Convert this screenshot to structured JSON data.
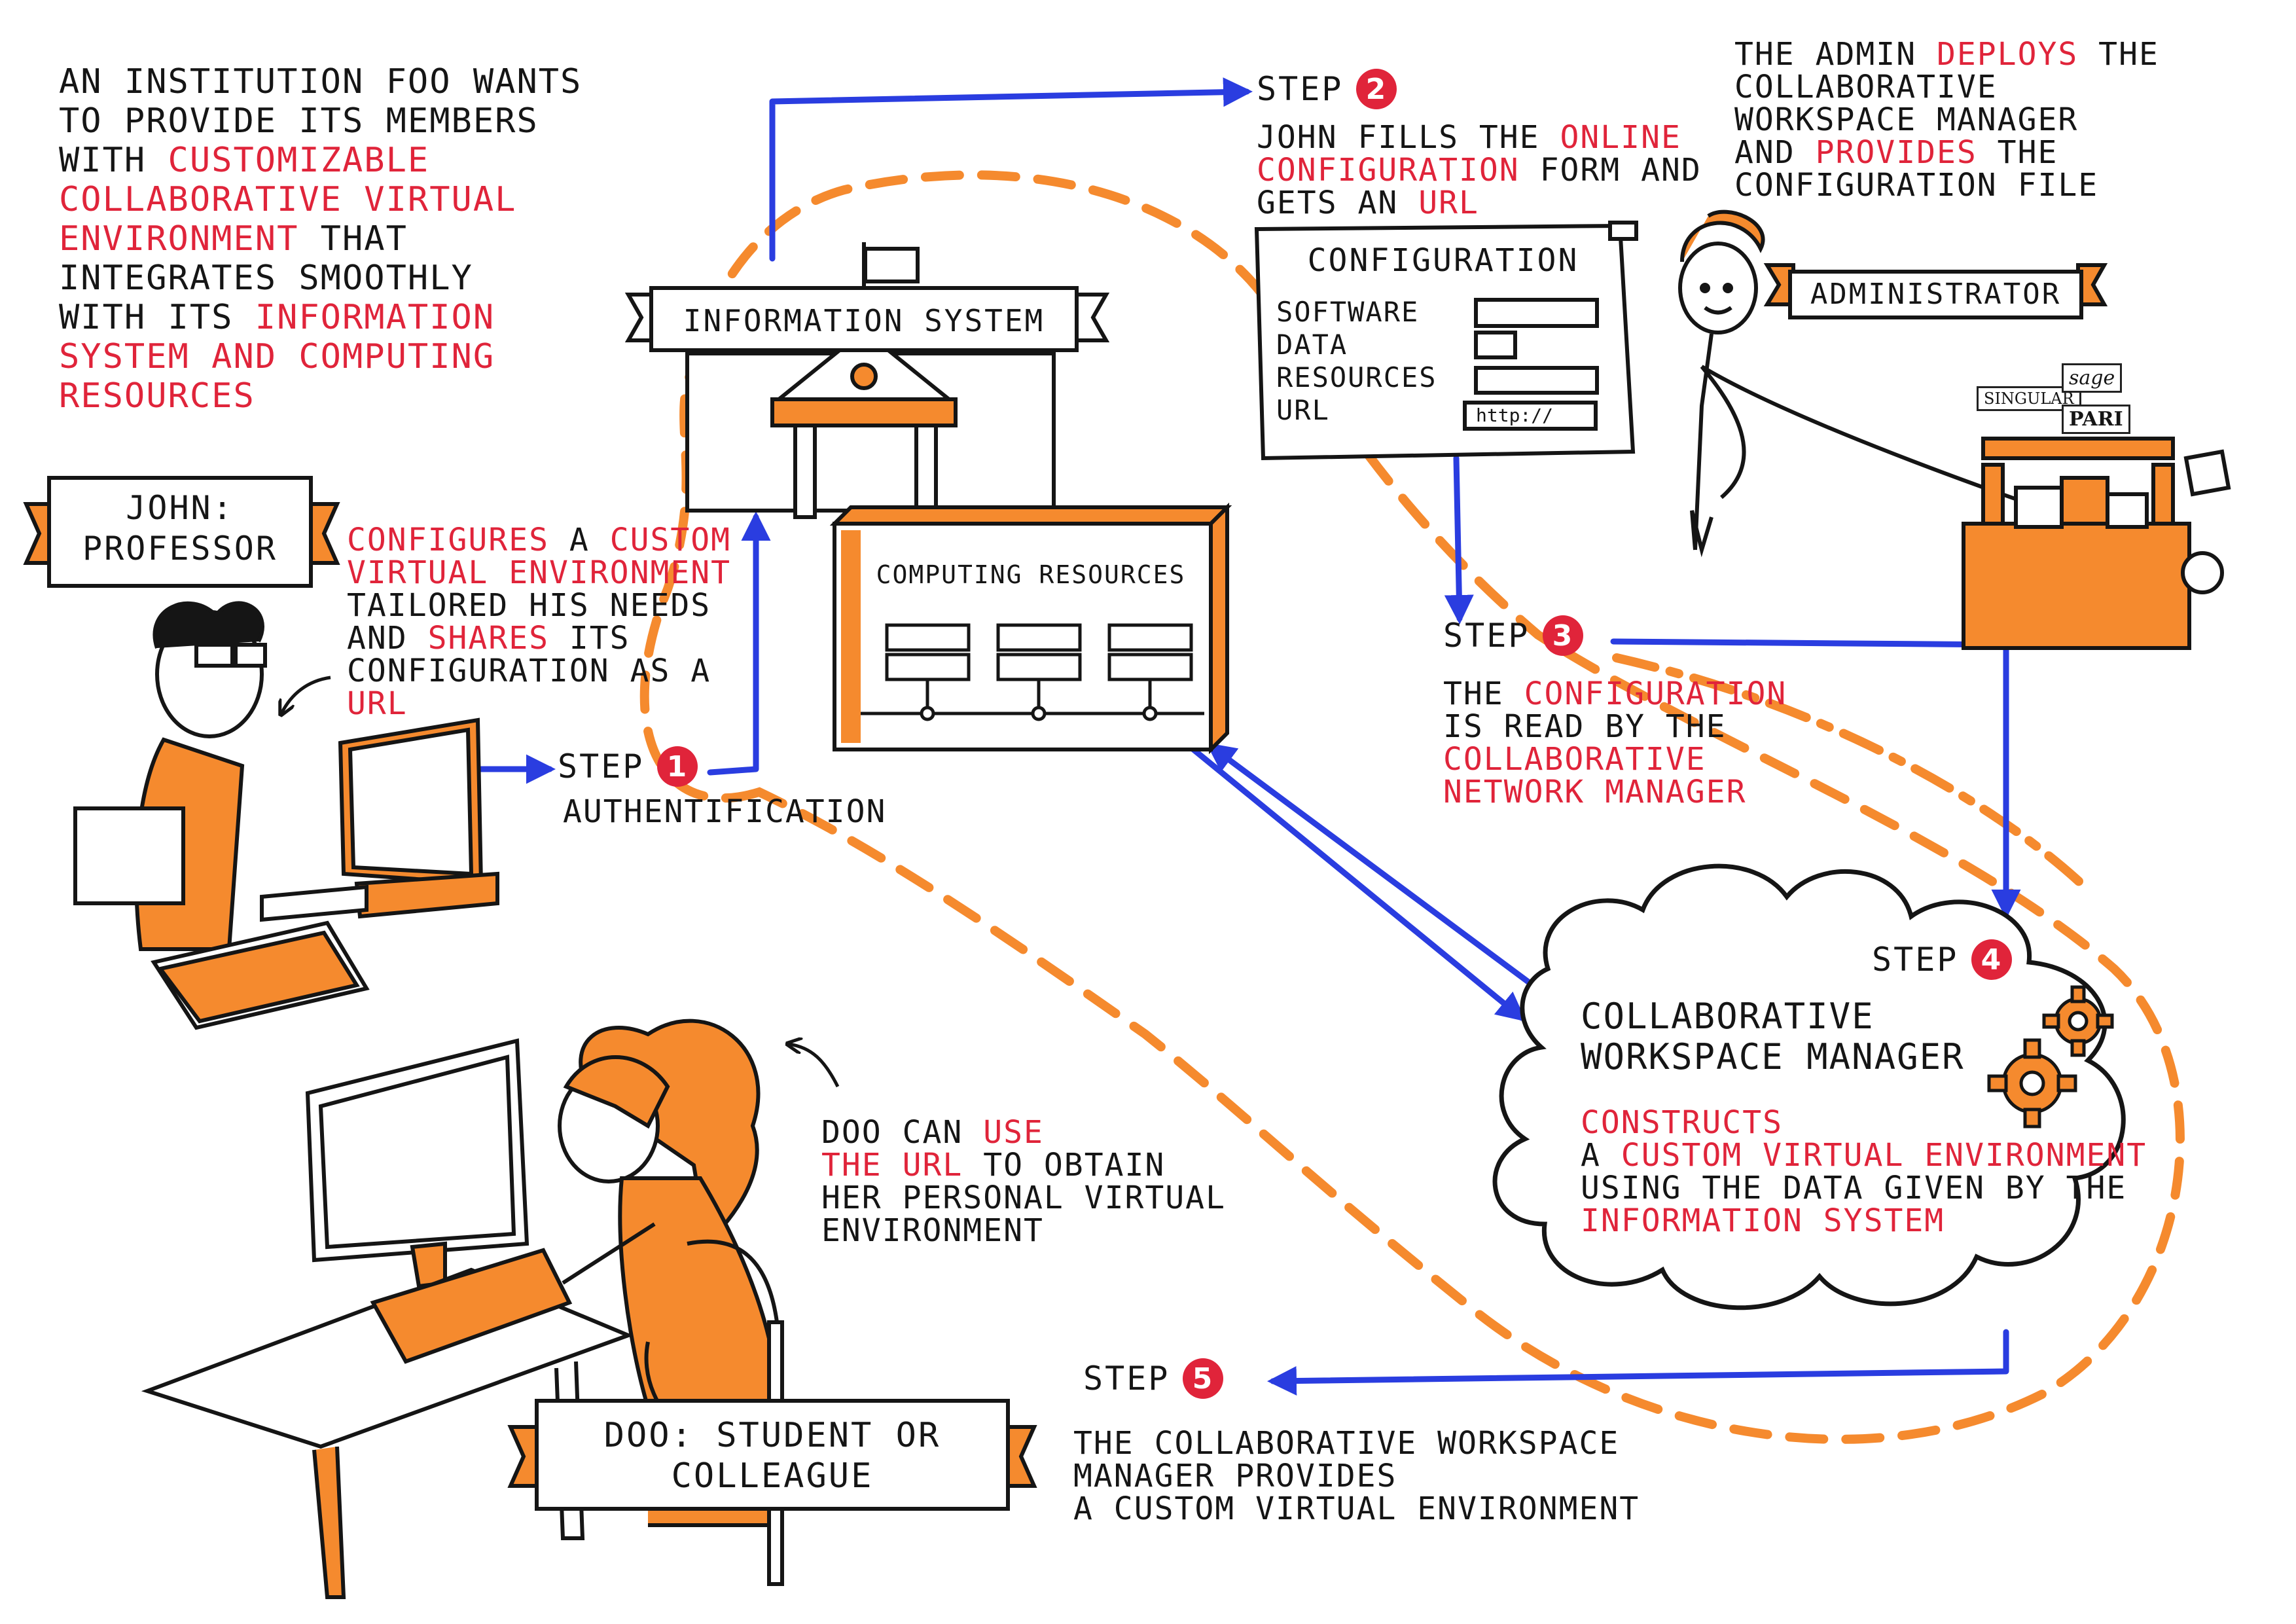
{
  "intro": {
    "lines": [
      [
        {
          "t": "AN INSTITUTION FOO WANTS",
          "r": false
        }
      ],
      [
        {
          "t": "TO PROVIDE ITS MEMBERS",
          "r": false
        }
      ],
      [
        {
          "t": "WITH ",
          "r": false
        },
        {
          "t": "CUSTOMIZABLE",
          "r": true
        }
      ],
      [
        {
          "t": "COLLABORATIVE VIRTUAL",
          "r": true
        }
      ],
      [
        {
          "t": "ENVIRONMENT",
          "r": true
        },
        {
          "t": " THAT",
          "r": false
        }
      ],
      [
        {
          "t": "INTEGRATES SMOOTHLY",
          "r": false
        }
      ],
      [
        {
          "t": "WITH ITS ",
          "r": false
        },
        {
          "t": "INFORMATION",
          "r": true
        }
      ],
      [
        {
          "t": "SYSTEM AND COMPUTING",
          "r": true
        }
      ],
      [
        {
          "t": "RESOURCES",
          "r": true
        }
      ]
    ]
  },
  "john": {
    "label_line1": "JOHN:",
    "label_line2": "PROFESSOR",
    "text": [
      [
        {
          "t": "CONFIGURES",
          "r": true
        },
        {
          "t": " A ",
          "r": false
        },
        {
          "t": "CUSTOM",
          "r": true
        }
      ],
      [
        {
          "t": "VIRTUAL ENVIRONMENT",
          "r": true
        }
      ],
      [
        {
          "t": "TAILORED HIS NEEDS",
          "r": false
        }
      ],
      [
        {
          "t": "AND ",
          "r": false
        },
        {
          "t": "SHARES",
          "r": true
        },
        {
          "t": " ITS",
          "r": false
        }
      ],
      [
        {
          "t": "CONFIGURATION AS A",
          "r": false
        }
      ],
      [
        {
          "t": "URL",
          "r": true
        }
      ]
    ]
  },
  "info_system": {
    "label": "INFORMATION SYSTEM"
  },
  "computing": {
    "label": "COMPUTING RESOURCES"
  },
  "steps": {
    "s1": {
      "word": "STEP",
      "num": "1",
      "desc": "AUTHENTIFICATION"
    },
    "s2": {
      "word": "STEP",
      "num": "2",
      "desc": [
        [
          {
            "t": "JOHN FILLS THE ",
            "r": false
          },
          {
            "t": "ONLINE",
            "r": true
          }
        ],
        [
          {
            "t": "CONFIGURATION",
            "r": true
          },
          {
            "t": " FORM AND",
            "r": false
          }
        ],
        [
          {
            "t": "GETS AN ",
            "r": false
          },
          {
            "t": "URL",
            "r": true
          }
        ]
      ]
    },
    "s3": {
      "word": "STEP",
      "num": "3",
      "desc": [
        [
          {
            "t": "THE ",
            "r": false
          },
          {
            "t": "CONFIGURATION",
            "r": true
          }
        ],
        [
          {
            "t": "IS READ BY THE",
            "r": false
          }
        ],
        [
          {
            "t": "COLLABORATIVE",
            "r": true
          }
        ],
        [
          {
            "t": "NETWORK MANAGER",
            "r": true
          }
        ]
      ]
    },
    "s4": {
      "word": "STEP",
      "num": "4"
    },
    "s5": {
      "word": "STEP",
      "num": "5",
      "desc": [
        [
          {
            "t": "THE COLLABORATIVE WORKSPACE",
            "r": false
          }
        ],
        [
          {
            "t": "MANAGER PROVIDES",
            "r": false
          }
        ],
        [
          {
            "t": "A CUSTOM VIRTUAL ENVIRONMENT",
            "r": false
          }
        ]
      ]
    }
  },
  "admin": {
    "text": [
      [
        {
          "t": "THE ADMIN ",
          "r": false
        },
        {
          "t": "DEPLOYS",
          "r": true
        },
        {
          "t": " THE",
          "r": false
        }
      ],
      [
        {
          "t": "COLLABORATIVE",
          "r": false
        }
      ],
      [
        {
          "t": "WORKSPACE MANAGER",
          "r": false
        }
      ],
      [
        {
          "t": "AND ",
          "r": false
        },
        {
          "t": "PROVIDES",
          "r": true
        },
        {
          "t": " THE",
          "r": false
        }
      ],
      [
        {
          "t": "CONFIGURATION FILE",
          "r": false
        }
      ]
    ],
    "label": "ADMINISTRATOR"
  },
  "config_form": {
    "title": "CONFIGURATION",
    "fields": [
      "SOFTWARE",
      "DATA",
      "RESOURCES",
      "URL"
    ],
    "url_value": "http://"
  },
  "tool_logos": [
    "SINGULAR",
    "sage",
    "PARI"
  ],
  "cwm": {
    "title_line1": "COLLABORATIVE",
    "title_line2": "WORKSPACE MANAGER",
    "text": [
      [
        {
          "t": "CONSTRUCTS",
          "r": true
        }
      ],
      [
        {
          "t": "A ",
          "r": false
        },
        {
          "t": "CUSTOM VIRTUAL ENVIRONMENT",
          "r": true
        }
      ],
      [
        {
          "t": "USING THE DATA GIVEN BY THE",
          "r": false
        }
      ],
      [
        {
          "t": "INFORMATION SYSTEM",
          "r": true
        }
      ]
    ]
  },
  "doo": {
    "text": [
      [
        {
          "t": "DOO CAN ",
          "r": false
        },
        {
          "t": "USE",
          "r": true
        }
      ],
      [
        {
          "t": "THE URL",
          "r": true
        },
        {
          "t": " TO OBTAIN",
          "r": false
        }
      ],
      [
        {
          "t": "HER PERSONAL VIRTUAL",
          "r": false
        }
      ],
      [
        {
          "t": "ENVIRONMENT",
          "r": false
        }
      ]
    ],
    "label_line1": "DOO: STUDENT OR",
    "label_line2": "COLLEAGUE"
  },
  "colors": {
    "accent_red": "#e0243a",
    "orange": "#f58a2e",
    "blue": "#2a3de0",
    "ink": "#151515"
  }
}
